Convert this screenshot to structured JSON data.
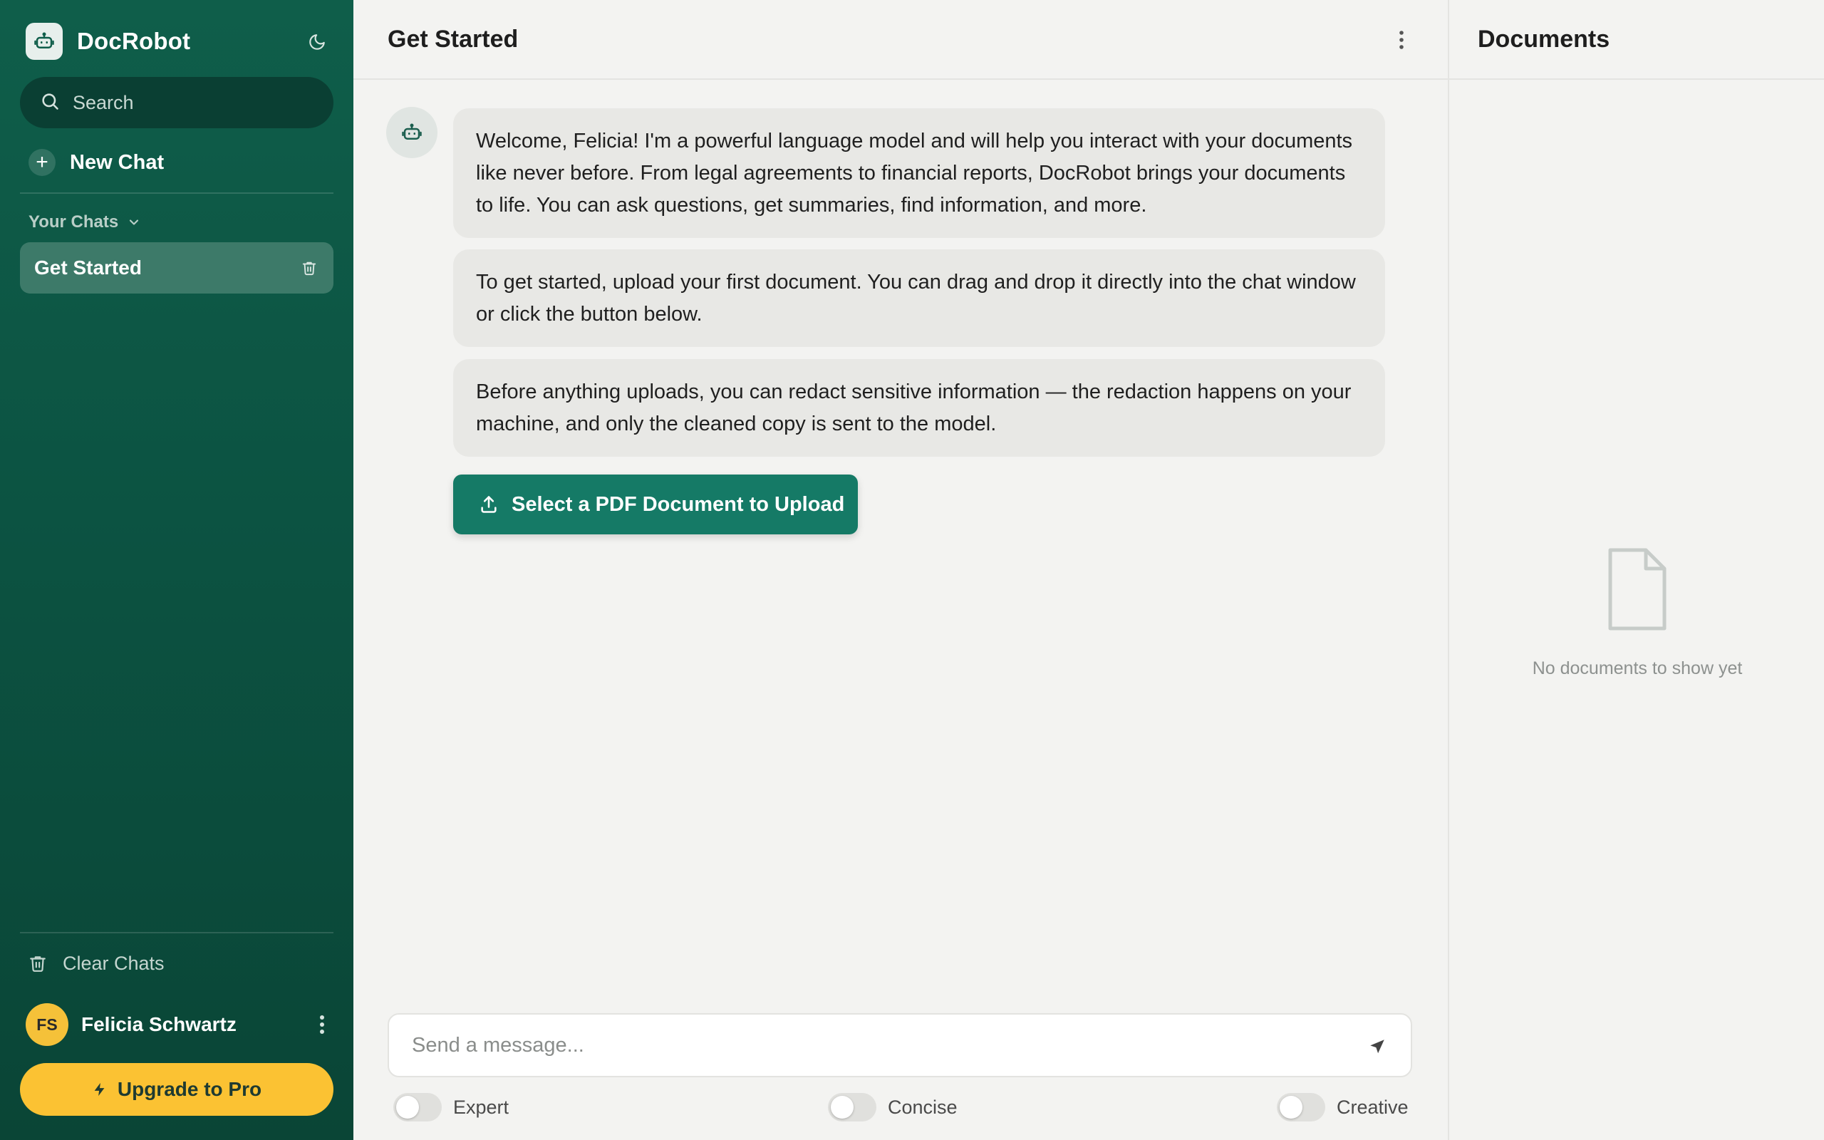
{
  "app": {
    "name": "DocRobot",
    "accent_color": "#157a66",
    "sidebar_color": "#0f5e4a",
    "upgrade_color": "#fbc233"
  },
  "sidebar": {
    "search_placeholder": "Search",
    "new_chat_label": "New Chat",
    "section_label": "Your Chats",
    "chats": [
      {
        "label": "Get Started",
        "active": true
      }
    ],
    "clear_chats_label": "Clear Chats",
    "user": {
      "initials": "FS",
      "name": "Felicia Schwartz"
    },
    "upgrade_label": "Upgrade to Pro"
  },
  "main": {
    "title": "Get Started",
    "messages": [
      "Welcome, Felicia! I'm a powerful language model and will help you interact with your documents like never before. From legal agreements to financial reports, DocRobot brings your documents to life. You can ask questions, get summaries, find information, and more.",
      "To get started, upload your first document. You can drag and drop it directly into the chat window or click the button below.",
      "Before anything uploads, you can redact sensitive information — the redaction happens on your machine, and only the cleaned copy is sent to the model."
    ],
    "upload_button_label": "Select a PDF Document to Upload",
    "composer_placeholder": "Send a message...",
    "toggles": [
      {
        "label": "Expert",
        "on": false
      },
      {
        "label": "Concise",
        "on": false
      },
      {
        "label": "Creative",
        "on": false
      }
    ]
  },
  "documents": {
    "title": "Documents",
    "empty_text": "No documents to show yet"
  },
  "icons": {
    "brand": "robot-icon",
    "theme": "moon-icon",
    "search": "search-icon",
    "new_chat": "plus-icon",
    "section_toggle": "chevron-down-icon",
    "chat_delete": "trash-icon",
    "clear_chats": "trash-icon",
    "user_menu": "vertical-dots-icon",
    "upgrade": "lightning-icon",
    "header_more": "vertical-dots-icon",
    "upload": "upload-icon",
    "send": "send-icon",
    "empty_document": "document-icon"
  }
}
